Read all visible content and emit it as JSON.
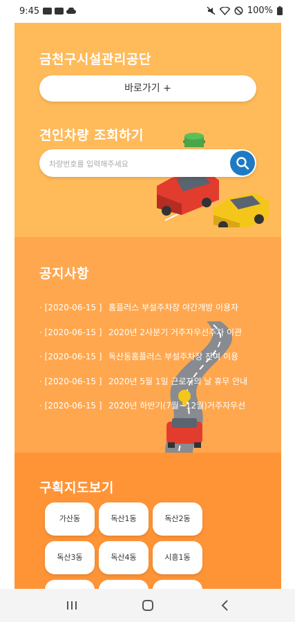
{
  "status_bar": {
    "time": "9:45",
    "battery": "100%",
    "icons": [
      "youtube-icon",
      "youtube-icon",
      "cloud-icon",
      "mute-icon",
      "wifi-icon",
      "block-icon",
      "battery-icon"
    ]
  },
  "header": {
    "title": "금천구시설관리공단",
    "shortcut_label": "바로가기 +"
  },
  "tow_search": {
    "title": "견인차량 조회하기",
    "placeholder": "차량번호를 입력해주세요",
    "button_icon": "search-icon"
  },
  "notices": {
    "title": "공지사항",
    "items": [
      {
        "date": "· [2020-06-15 ]",
        "title": "홈플러스 부설주차장 야간개방 이용자"
      },
      {
        "date": "· [2020-06-15 ]",
        "title": "2020년 2사분기 거주자우선주차 이관"
      },
      {
        "date": "· [2020-06-15 ]",
        "title": "독산동홈플러스 부설주차장 잔여 이용"
      },
      {
        "date": "· [2020-06-15 ]",
        "title": "2020년 5월 1일 근로자의 날 휴무 안내"
      },
      {
        "date": "· [2020-06-15 ]",
        "title": "2020년 하반기(7월~12월)거주자우선"
      }
    ]
  },
  "district_map": {
    "title": "구획지도보기",
    "items": [
      "가산동",
      "독산1동",
      "독산2동",
      "독산3동",
      "독산4동",
      "시흥1동",
      "",
      "",
      ""
    ]
  },
  "colors": {
    "panel_top": "#ffba5a",
    "panel_mid": "#ffa74e",
    "panel_bottom": "#ff9436",
    "search_button": "#1f7ac4"
  }
}
